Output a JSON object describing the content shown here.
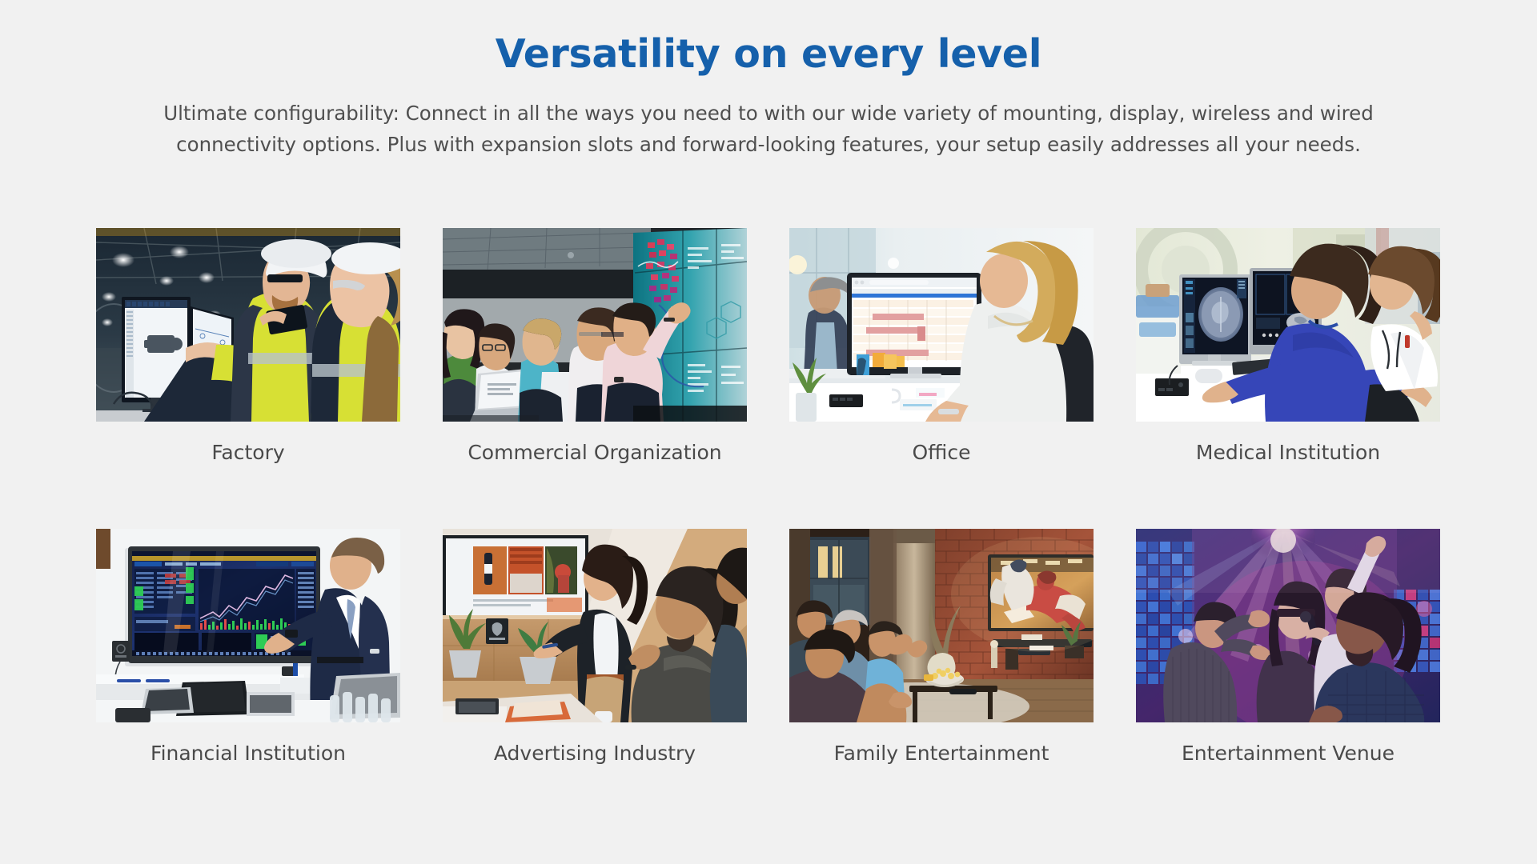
{
  "header": {
    "title": "Versatility on every level",
    "subtitle_line1": "Ultimate configurability: Connect in all the ways you need to with our wide variety of mounting, display, wireless and wired",
    "subtitle_line2": "connectivity options. Plus with expansion slots and forward-looking features, your setup easily addresses all your needs.",
    "title_color": "#1560ab",
    "text_color": "#4f4f4f",
    "background_color": "#f1f1f1"
  },
  "grid": {
    "columns": 4,
    "rows": 2,
    "cards": [
      {
        "caption": "Factory",
        "image_name": "factory-photo",
        "scene": "Two industrial engineers in hi-vis yellow jackets and white hard hats reviewing CAD drawings on dual monitors in a factory hall"
      },
      {
        "caption": "Commercial Organization",
        "image_name": "commercial-organization-photo",
        "scene": "Group of colleagues in a dark meeting room watching a man point at a large data-visualization video wall"
      },
      {
        "caption": "Office",
        "image_name": "office-photo",
        "scene": "Blonde woman seen from behind working at an all-in-one desktop monitor showing a spreadsheet at an office desk"
      },
      {
        "caption": "Medical Institution",
        "image_name": "medical-institution-photo",
        "scene": "Doctor in blue scrubs and a colleague in a white coat reviewing brain CT scans on dual diagnostic monitors"
      },
      {
        "caption": "Financial Institution",
        "image_name": "financial-institution-photo",
        "scene": "Businessman in a navy suit presenting stock-trading dashboards on a large wall-mounted interactive display in a boardroom"
      },
      {
        "caption": "Advertising Industry",
        "image_name": "advertising-industry-photo",
        "scene": "Smiling woman presenting a campaign mood board on a wall display to seated colleagues in a wood-panelled creative studio"
      },
      {
        "caption": "Family Entertainment",
        "image_name": "family-entertainment-photo",
        "scene": "Family and friends cheering on a sofa while watching a baseball game on a large TV mounted on an exposed brick wall"
      },
      {
        "caption": "Entertainment Venue",
        "image_name": "entertainment-venue-photo",
        "scene": "Four friends singing karaoke with microphones under colorful stage lights and an LED video wall at a club"
      }
    ]
  }
}
